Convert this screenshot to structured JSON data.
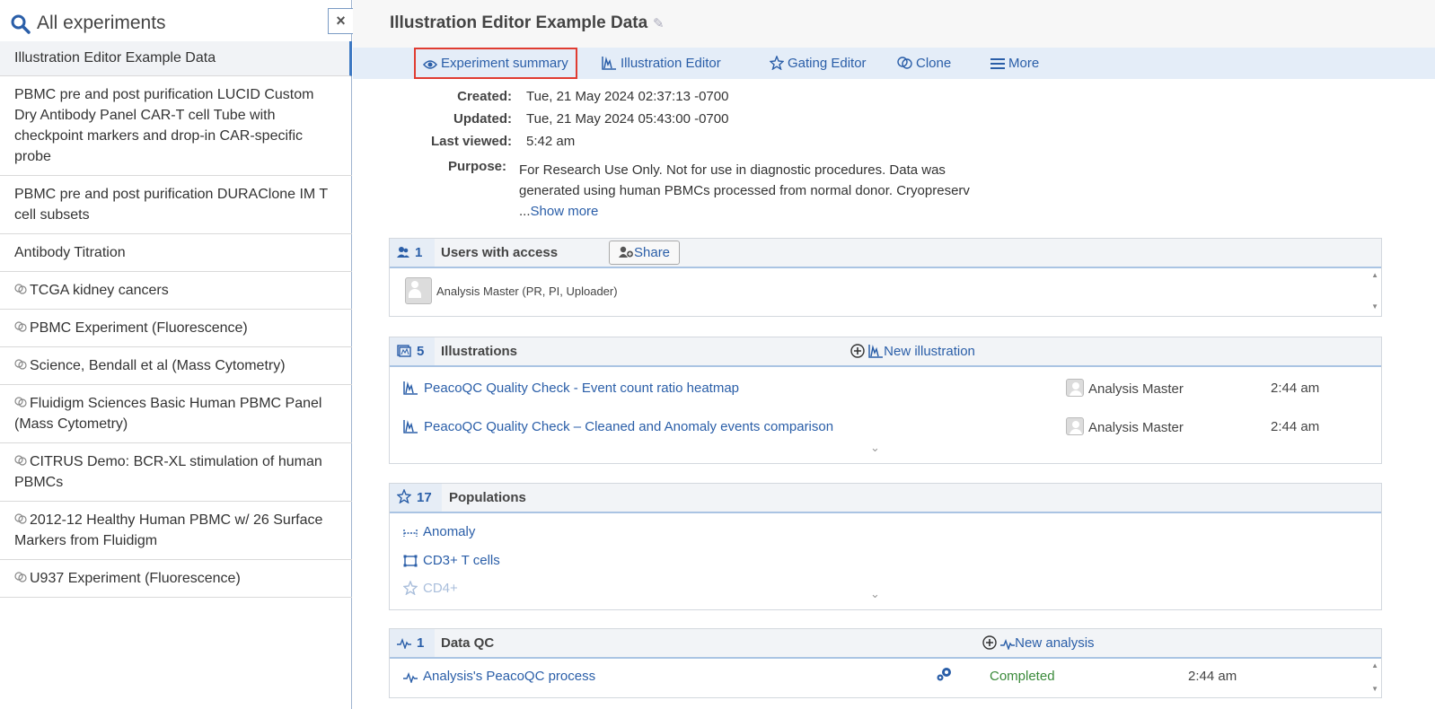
{
  "sidebar": {
    "title": "All experiments",
    "close_label": "×",
    "items": [
      {
        "label": "Illustration Editor Example Data",
        "public": false
      },
      {
        "label": "PBMC pre and post purification LUCID Custom Dry Antibody Panel CAR-T cell Tube with checkpoint markers and drop-in CAR-specific probe",
        "public": false
      },
      {
        "label": "PBMC pre and post purification DURAClone IM T cell subsets",
        "public": false
      },
      {
        "label": "Antibody Titration",
        "public": false
      },
      {
        "label": "TCGA kidney cancers",
        "public": true
      },
      {
        "label": "PBMC Experiment (Fluorescence)",
        "public": true
      },
      {
        "label": "Science, Bendall et al (Mass Cytometry)",
        "public": true
      },
      {
        "label": "Fluidigm Sciences Basic Human PBMC Panel (Mass Cytometry)",
        "public": true
      },
      {
        "label": "CITRUS Demo: BCR-XL stimulation of human PBMCs",
        "public": true
      },
      {
        "label": "2012-12 Healthy Human PBMC w/ 26 Surface Markers from Fluidigm",
        "public": true
      },
      {
        "label": "U937 Experiment (Fluorescence)",
        "public": true
      }
    ]
  },
  "header": {
    "title": "Illustration Editor Example Data"
  },
  "tabs": [
    {
      "label": "Experiment summary",
      "icon": "eye-icon",
      "active": true
    },
    {
      "label": "Illustration Editor",
      "icon": "histogram-icon",
      "active": false
    },
    {
      "label": "Gating Editor",
      "icon": "star-icon",
      "active": false
    },
    {
      "label": "Clone",
      "icon": "clone-icon",
      "active": false
    },
    {
      "label": "More",
      "icon": "menu-icon",
      "active": false
    }
  ],
  "meta": {
    "created_label": "Created:",
    "created": "Tue, 21 May 2024 02:37:13 -0700",
    "updated_label": "Updated:",
    "updated": "Tue, 21 May 2024 05:43:00 -0700",
    "last_viewed_label": "Last viewed:",
    "last_viewed": "5:42 am",
    "purpose_label": "Purpose:",
    "purpose": "For Research Use Only. Not for use in diagnostic procedures. Data was generated using human PBMCs processed from normal donor. Cryopreserv ...",
    "show_more": "Show more"
  },
  "users_panel": {
    "count": "1",
    "title": "Users with access",
    "share_label": "Share",
    "users": [
      "Analysis Master (PR, PI, Uploader)"
    ]
  },
  "illustrations_panel": {
    "count": "5",
    "title": "Illustrations",
    "new_label": "New illustration",
    "rows": [
      {
        "name": "PeacoQC Quality Check - Event count ratio heatmap",
        "owner": "Analysis Master",
        "time": "2:44 am"
      },
      {
        "name": "PeacoQC Quality Check – Cleaned and Anomaly events comparison",
        "owner": "Analysis Master",
        "time": "2:44 am"
      }
    ]
  },
  "populations_panel": {
    "count": "17",
    "title": "Populations",
    "rows": [
      {
        "name": "Anomaly",
        "icon": "range-gate-icon"
      },
      {
        "name": "CD3+ T cells",
        "icon": "rectangle-gate-icon"
      },
      {
        "name": "CD4+",
        "icon": "star-icon"
      }
    ]
  },
  "dataqc_panel": {
    "count": "1",
    "title": "Data QC",
    "new_label": "New analysis",
    "rows": [
      {
        "name": "Analysis's PeacoQC process",
        "status": "Completed",
        "time": "2:44 am"
      }
    ]
  },
  "colors": {
    "link": "#2a5ea8",
    "active_tab_border": "#e03c31",
    "status_completed": "#3a8a3a"
  }
}
